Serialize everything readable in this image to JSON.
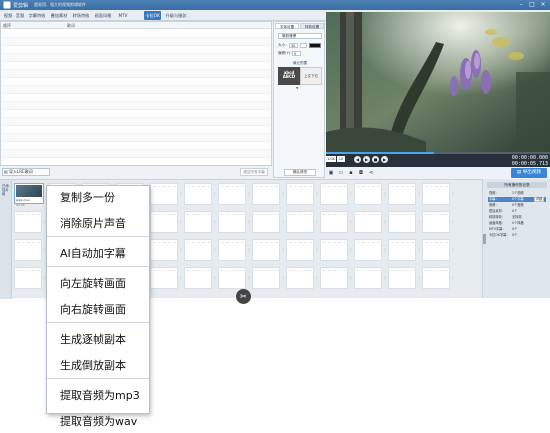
{
  "app": {
    "name": "爱剪辑",
    "subtitle": "超易用、强大的视频剪辑软件"
  },
  "tabs": [
    "视频",
    "音频",
    "字幕特效",
    "叠加素材",
    "转场特效",
    "画面风格",
    "MTV",
    "卡拉OK",
    "升级与服务"
  ],
  "active_tab": "卡拉OK",
  "subtitle_list": {
    "columns": [
      "顺序",
      "歌词"
    ]
  },
  "import_button": "导入LRC歌词",
  "clear_button": "清空所有字幕",
  "style_panel": {
    "tabs": [
      "字体设置",
      "特效设置"
    ],
    "font": "微软雅黑",
    "size_label": "大小：",
    "size_value": "30",
    "color_label": "颜色：",
    "position_label": "偏移(Y)：",
    "position_value": "0",
    "preset_title": "最近预置",
    "preset1": "abcd ABCD",
    "preset2": "上文下右",
    "apply_button": "确认修改"
  },
  "player": {
    "speed": "1.0X",
    "speed2": "1X",
    "current_time": "00:00:00.000",
    "total_time": "00:00:05.713",
    "progress": 0.48
  },
  "export_button": "导出视频",
  "timeline": {
    "side_label": "已添加片段",
    "clip_name": "jpg1.mov",
    "clip_duration": "00:06"
  },
  "sidebar": {
    "title": "所有操作的记录",
    "rows": [
      {
        "key": "视频：",
        "val": "1个视频",
        "btn": ""
      },
      {
        "key": "字幕：",
        "val": "0个字幕",
        "btn": "详细"
      },
      {
        "key": "音频：",
        "val": "0个音频",
        "btn": ""
      },
      {
        "key": "叠加素材：",
        "val": "0个",
        "btn": ""
      },
      {
        "key": "转场特效：",
        "val": "无特效",
        "btn": ""
      },
      {
        "key": "画面风格：",
        "val": "0个风格",
        "btn": ""
      },
      {
        "key": "MTV字幕：",
        "val": "0个",
        "btn": ""
      },
      {
        "key": "卡拉OK字幕：",
        "val": "0个",
        "btn": ""
      }
    ]
  },
  "context_menu": [
    {
      "label": "复制多一份",
      "sep_after": false
    },
    {
      "label": "消除原片声音",
      "sep_after": true
    },
    {
      "label": "AI自动加字幕",
      "sep_after": true
    },
    {
      "label": "向左旋转画面",
      "sep_after": false
    },
    {
      "label": "向右旋转画面",
      "sep_after": true
    },
    {
      "label": "生成逐帧副本",
      "sep_after": false
    },
    {
      "label": "生成倒放副本",
      "sep_after": true
    },
    {
      "label": "提取音频为mp3",
      "sep_after": false
    },
    {
      "label": "提取音频为wav",
      "sep_after": false
    }
  ],
  "colors": {
    "accent": "#3a78c2",
    "export": "#3a85d6",
    "title_bar": "#3f73a8"
  }
}
